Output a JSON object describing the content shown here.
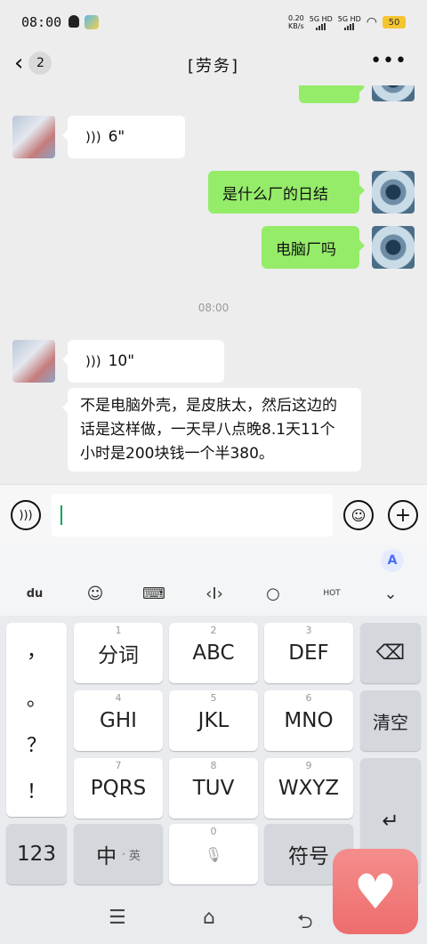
{
  "status": {
    "time": "08:00",
    "net_speed_top": "0.20",
    "net_speed_bottom": "KB/s",
    "sim1": "5G HD",
    "sim2": "5G HD",
    "battery": "50"
  },
  "header": {
    "back_count": "2",
    "title": "[劳务]"
  },
  "messages": [
    {
      "side": "in",
      "type": "voice",
      "duration": "6\""
    },
    {
      "side": "out",
      "type": "text",
      "text": "是什么厂的日结"
    },
    {
      "side": "out",
      "type": "text",
      "text": "电脑厂吗"
    },
    {
      "timestamp": "08:00"
    },
    {
      "side": "in",
      "type": "voice",
      "duration": "10\""
    },
    {
      "side": "in",
      "type": "text",
      "text": "不是电脑外壳，是皮肤太，然后这边的话是这样做，一天早八点晚8.1天11个小时是200块钱一个半380。"
    }
  ],
  "input": {
    "value": ""
  },
  "keyboard": {
    "punct": [
      "，",
      "。",
      "？",
      "！"
    ],
    "rows": [
      [
        {
          "label": "分词",
          "num": "1"
        },
        {
          "label": "ABC",
          "num": "2"
        },
        {
          "label": "DEF",
          "num": "3"
        }
      ],
      [
        {
          "label": "GHI",
          "num": "4"
        },
        {
          "label": "JKL",
          "num": "5"
        },
        {
          "label": "MNO",
          "num": "6"
        }
      ],
      [
        {
          "label": "PQRS",
          "num": "7"
        },
        {
          "label": "TUV",
          "num": "8"
        },
        {
          "label": "WXYZ",
          "num": "9"
        }
      ]
    ],
    "clear": "清空",
    "num_key": "123",
    "lang_key": "中",
    "lang_sub": "英",
    "space_num": "0",
    "symbol_key": "符号",
    "ai_badge": "A"
  }
}
